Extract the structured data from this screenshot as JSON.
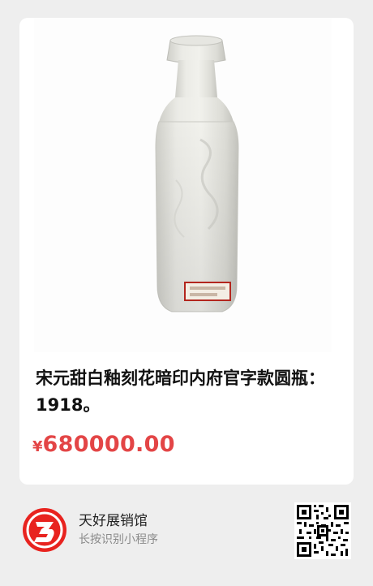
{
  "product": {
    "image_alt": "white glazed vase",
    "title": "宋元甜白釉刻花暗印内府官字款圆瓶：1918。",
    "price_currency": "¥",
    "price_value": "680000.00"
  },
  "shop": {
    "name": "天好展销馆",
    "hint": "长按识别小程序",
    "logo_icon": "red-circle-three-logo",
    "qr_icon": "mini-program-qr-code"
  },
  "colors": {
    "price": "#e34546",
    "background": "#eeeeee",
    "card": "#ffffff",
    "logo_red": "#e8231f"
  }
}
